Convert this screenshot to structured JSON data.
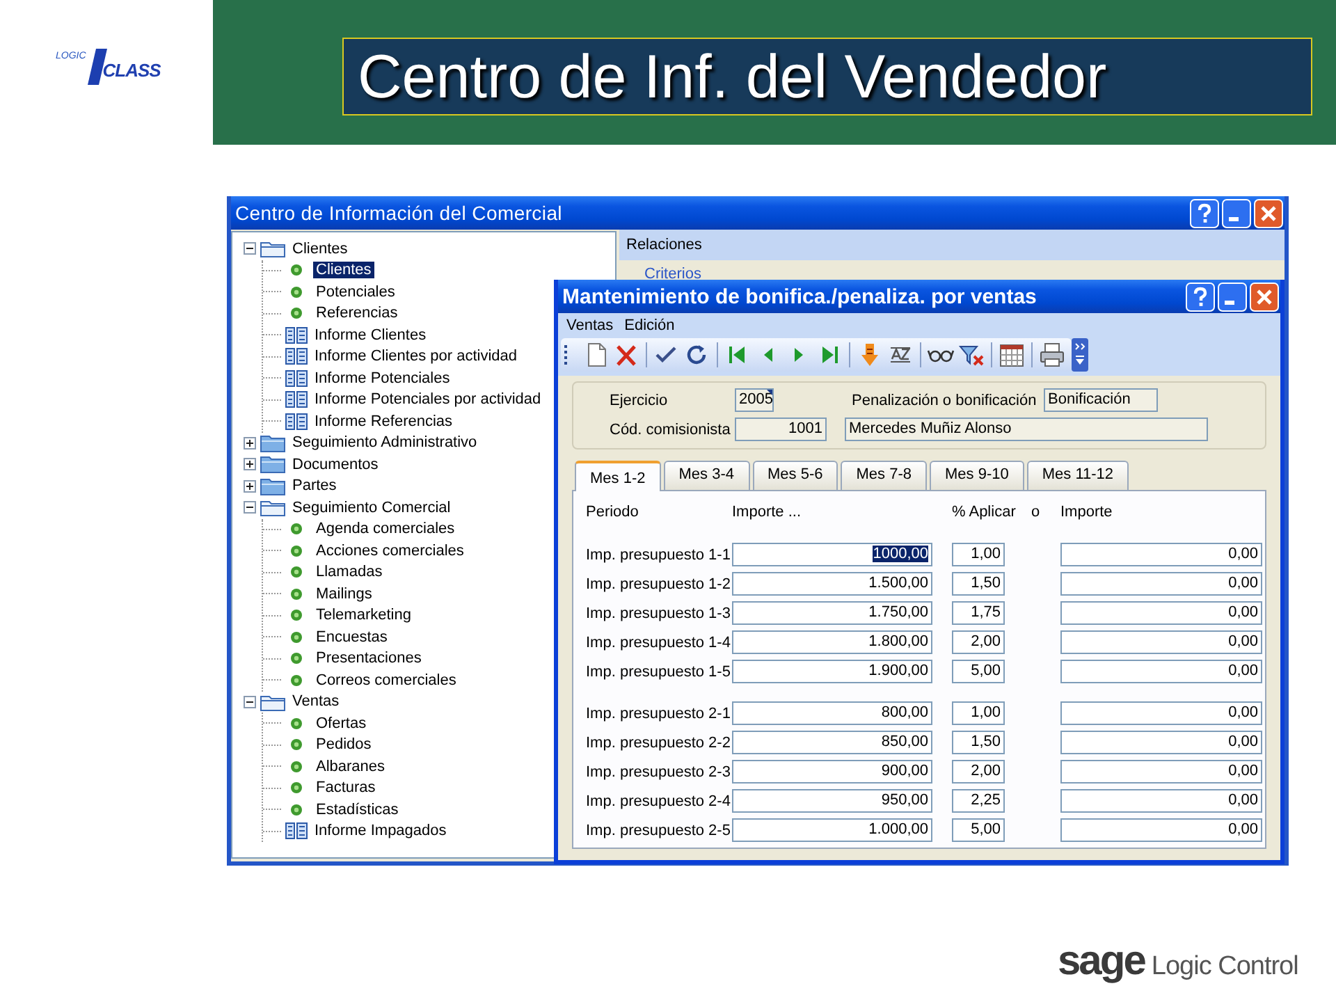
{
  "logo": {
    "word_top": "LOGIC",
    "word_main": "CLASS"
  },
  "slide_title": "Centro de Inf. del Vendedor",
  "back_window": {
    "title": "Centro de Información del Comercial",
    "relations_bar": "Relaciones",
    "criteria_link": "Criterios",
    "tree": [
      {
        "label": "Clientes",
        "kind": "folder",
        "expanded": true,
        "selected": false,
        "children": [
          {
            "label": "Clientes",
            "kind": "dot",
            "selected": true
          },
          {
            "label": "Potenciales",
            "kind": "dot",
            "selected": false
          },
          {
            "label": "Referencias",
            "kind": "dot",
            "selected": false
          },
          {
            "label": "Informe Clientes",
            "kind": "report",
            "selected": false
          },
          {
            "label": "Informe Clientes por actividad",
            "kind": "report",
            "selected": false
          },
          {
            "label": "Informe Potenciales",
            "kind": "report",
            "selected": false
          },
          {
            "label": "Informe Potenciales por actividad",
            "kind": "report",
            "selected": false
          },
          {
            "label": "Informe Referencias",
            "kind": "report",
            "selected": false
          }
        ]
      },
      {
        "label": "Seguimiento Administrativo",
        "kind": "folder",
        "expanded": false,
        "selected": false
      },
      {
        "label": "Documentos",
        "kind": "folder",
        "expanded": false,
        "selected": false
      },
      {
        "label": "Partes",
        "kind": "folder",
        "expanded": false,
        "selected": false
      },
      {
        "label": "Seguimiento Comercial",
        "kind": "folder",
        "expanded": true,
        "selected": false,
        "children": [
          {
            "label": "Agenda comerciales",
            "kind": "dot",
            "selected": false
          },
          {
            "label": "Acciones comerciales",
            "kind": "dot",
            "selected": false
          },
          {
            "label": "Llamadas",
            "kind": "dot",
            "selected": false
          },
          {
            "label": "Mailings",
            "kind": "dot",
            "selected": false
          },
          {
            "label": "Telemarketing",
            "kind": "dot",
            "selected": false
          },
          {
            "label": "Encuestas",
            "kind": "dot",
            "selected": false
          },
          {
            "label": "Presentaciones",
            "kind": "dot",
            "selected": false
          },
          {
            "label": "Correos comerciales",
            "kind": "dot",
            "selected": false
          }
        ]
      },
      {
        "label": "Ventas",
        "kind": "folder",
        "expanded": true,
        "selected": false,
        "children": [
          {
            "label": "Ofertas",
            "kind": "dot",
            "selected": false
          },
          {
            "label": "Pedidos",
            "kind": "dot",
            "selected": false
          },
          {
            "label": "Albaranes",
            "kind": "dot",
            "selected": false
          },
          {
            "label": "Facturas",
            "kind": "dot",
            "selected": false
          },
          {
            "label": "Estadísticas",
            "kind": "dot",
            "selected": false
          },
          {
            "label": "Informe Impagados",
            "kind": "report",
            "selected": false
          }
        ]
      }
    ]
  },
  "front_window": {
    "title": "Mantenimiento de bonifica./penaliza. por ventas",
    "menu": [
      "Ventas",
      "Edición"
    ],
    "header": {
      "ejercicio_label": "Ejercicio",
      "ejercicio": "2005",
      "tipo_label": "Penalización o bonificación",
      "tipo": "Bonificación",
      "comisionista_label": "Cód. comisionista",
      "comisionista_code": "1001",
      "comisionista_name": "Mercedes Muñiz Alonso"
    },
    "tabs": [
      {
        "label": "Mes 1-2",
        "selected": true
      },
      {
        "label": "Mes 3-4",
        "selected": false
      },
      {
        "label": "Mes 5-6",
        "selected": false
      },
      {
        "label": "Mes 7-8",
        "selected": false
      },
      {
        "label": "Mes 9-10",
        "selected": false
      },
      {
        "label": "Mes 11-12",
        "selected": false
      }
    ],
    "columns": [
      "Periodo",
      "Importe ...",
      "% Aplicar",
      "o",
      "Importe"
    ],
    "groups": [
      [
        {
          "label": "Imp. presupuesto 1-1",
          "importe": "1000,00",
          "importe_selected": true,
          "percent": "1,00",
          "importe_2": "0,00"
        },
        {
          "label": "Imp. presupuesto 1-2",
          "importe": "1.500,00",
          "importe_selected": false,
          "percent": "1,50",
          "importe_2": "0,00"
        },
        {
          "label": "Imp. presupuesto 1-3",
          "importe": "1.750,00",
          "importe_selected": false,
          "percent": "1,75",
          "importe_2": "0,00"
        },
        {
          "label": "Imp. presupuesto 1-4",
          "importe": "1.800,00",
          "importe_selected": false,
          "percent": "2,00",
          "importe_2": "0,00"
        },
        {
          "label": "Imp. presupuesto 1-5",
          "importe": "1.900,00",
          "importe_selected": false,
          "percent": "5,00",
          "importe_2": "0,00"
        }
      ],
      [
        {
          "label": "Imp. presupuesto 2-1",
          "importe": "800,00",
          "importe_selected": false,
          "percent": "1,00",
          "importe_2": "0,00"
        },
        {
          "label": "Imp. presupuesto 2-2",
          "importe": "850,00",
          "importe_selected": false,
          "percent": "1,50",
          "importe_2": "0,00"
        },
        {
          "label": "Imp. presupuesto 2-3",
          "importe": "900,00",
          "importe_selected": false,
          "percent": "2,00",
          "importe_2": "0,00"
        },
        {
          "label": "Imp. presupuesto 2-4",
          "importe": "950,00",
          "importe_selected": false,
          "percent": "2,25",
          "importe_2": "0,00"
        },
        {
          "label": "Imp. presupuesto 2-5",
          "importe": "1.000,00",
          "importe_selected": false,
          "percent": "5,00",
          "importe_2": "0,00"
        }
      ]
    ]
  },
  "footer_logo": {
    "brand": "sage",
    "product": "Logic Control"
  }
}
